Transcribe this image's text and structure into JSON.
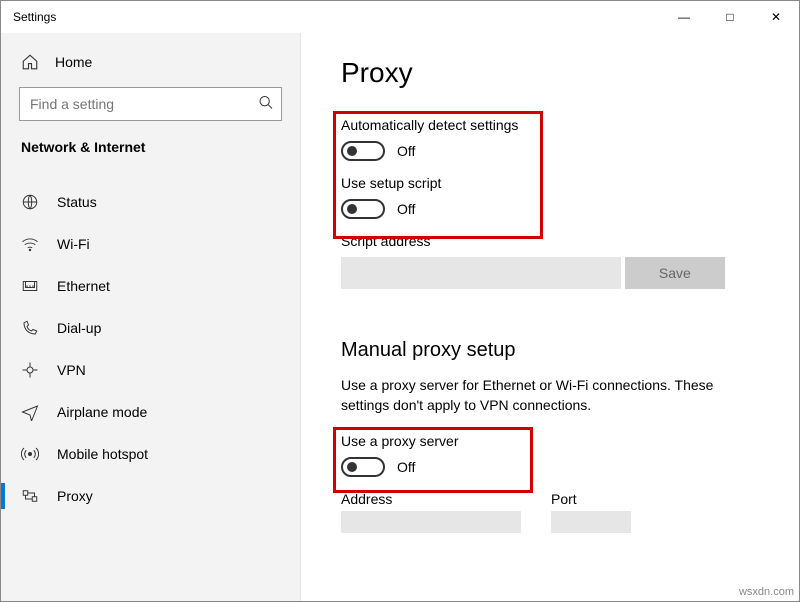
{
  "window": {
    "title": "Settings",
    "minimize_icon": "—",
    "maximize_icon": "□",
    "close_icon": "✕"
  },
  "sidebar": {
    "home_label": "Home",
    "search_placeholder": "Find a setting",
    "category_label": "Network & Internet",
    "items": [
      {
        "label": "Status"
      },
      {
        "label": "Wi-Fi"
      },
      {
        "label": "Ethernet"
      },
      {
        "label": "Dial-up"
      },
      {
        "label": "VPN"
      },
      {
        "label": "Airplane mode"
      },
      {
        "label": "Mobile hotspot"
      },
      {
        "label": "Proxy"
      }
    ],
    "selected_index": 7
  },
  "main": {
    "title": "Proxy",
    "auto_detect_label": "Automatically detect settings",
    "auto_detect_state": "Off",
    "setup_script_label": "Use setup script",
    "setup_script_state": "Off",
    "script_address_label": "Script address",
    "script_address_value": "",
    "save_label": "Save",
    "manual_heading": "Manual proxy setup",
    "manual_description": "Use a proxy server for Ethernet or Wi-Fi connections. These settings don't apply to VPN connections.",
    "use_proxy_label": "Use a proxy server",
    "use_proxy_state": "Off",
    "address_label": "Address",
    "address_value": "",
    "port_label": "Port",
    "port_value": ""
  },
  "watermark": "wsxdn.com"
}
